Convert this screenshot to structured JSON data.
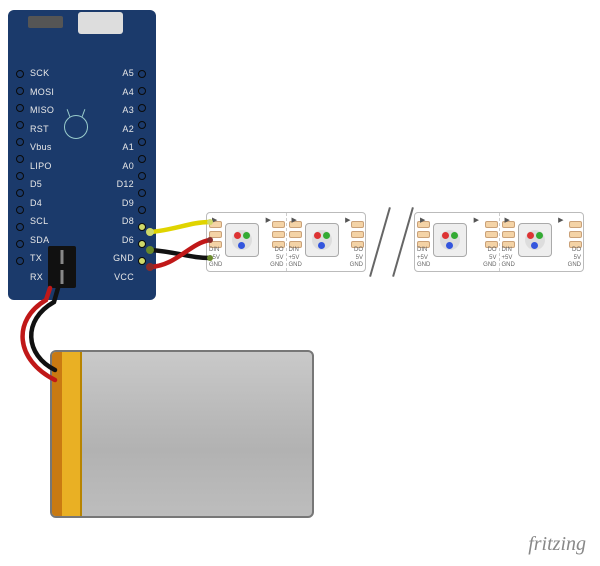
{
  "board": {
    "left_pins": [
      "SCK",
      "MOSI",
      "MISO",
      "RST",
      "Vbus",
      "LIPO",
      "D5",
      "D4",
      "SCL",
      "SDA",
      "TX",
      "RX"
    ],
    "right_pins": [
      "A5",
      "A4",
      "A3",
      "A2",
      "A1",
      "A0",
      "D12",
      "D9",
      "D8",
      "D6",
      "GND",
      "VCC"
    ],
    "highlighted_pins": [
      "D6",
      "GND",
      "VCC"
    ]
  },
  "strip": {
    "pixel_count_shown": 4,
    "pad_in": [
      "DIN",
      "+5V",
      "GND"
    ],
    "pad_out": [
      "DO",
      "5V",
      "GND"
    ],
    "arrow_in": "▶",
    "arrow_out": "▶"
  },
  "wires": [
    {
      "name": "data",
      "color": "#e0d400",
      "from": "board.D6",
      "to": "strip.DIN"
    },
    {
      "name": "ground",
      "color": "#111111",
      "from": "board.GND",
      "to": "strip.GND"
    },
    {
      "name": "power",
      "color": "#c01818",
      "from": "board.VCC",
      "to": "strip.+5V"
    },
    {
      "name": "batt_pos",
      "color": "#c01818",
      "from": "battery.+",
      "to": "board.JST+"
    },
    {
      "name": "batt_neg",
      "color": "#111111",
      "from": "battery.-",
      "to": "board.JST-"
    }
  ],
  "battery": {
    "type": "LiPo",
    "visible_label": ""
  },
  "credit": "fritzing"
}
